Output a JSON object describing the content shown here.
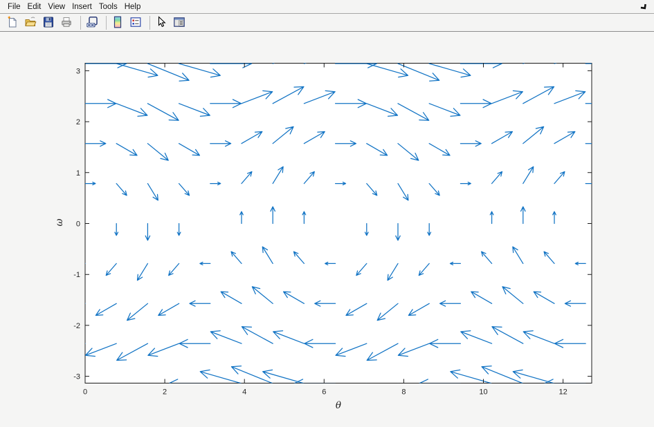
{
  "menu": {
    "items": [
      "File",
      "Edit",
      "View",
      "Insert",
      "Tools",
      "Help"
    ]
  },
  "toolbar": {
    "buttons": [
      {
        "name": "new-figure",
        "icon": "new-document-icon"
      },
      {
        "name": "open-file",
        "icon": "open-folder-icon"
      },
      {
        "name": "save-figure",
        "icon": "save-icon"
      },
      {
        "name": "print-figure",
        "icon": "print-icon"
      },
      {
        "name": "separator"
      },
      {
        "name": "link-plot",
        "icon": "link-plot-icon"
      },
      {
        "name": "separator"
      },
      {
        "name": "insert-colorbar",
        "icon": "colorbar-icon"
      },
      {
        "name": "insert-legend",
        "icon": "legend-icon"
      },
      {
        "name": "separator"
      },
      {
        "name": "edit-plot",
        "icon": "pointer-icon"
      },
      {
        "name": "show-plot-tools",
        "icon": "plot-tools-icon"
      }
    ]
  },
  "window": {
    "cursor_glyph": "se-arrow-cursor-icon"
  },
  "chart_data": {
    "type": "quiver",
    "title": "",
    "xlabel": "θ",
    "ylabel": "ω",
    "xlim": [
      0,
      12.72
    ],
    "ylim": [
      -3.1416,
      3.1416
    ],
    "x_ticks": [
      0,
      2,
      4,
      6,
      8,
      10,
      12
    ],
    "y_ticks": [
      -3,
      -2,
      -1,
      0,
      1,
      2,
      3
    ],
    "grid": false,
    "box": true,
    "legend_position": "none",
    "arrow_color": "#1173c4",
    "axis_color": "#1a1a1a",
    "background": "#ffffff",
    "arrow_scale": 0.33,
    "theta": [
      0,
      0.7854,
      1.5708,
      2.3562,
      3.1416,
      3.927,
      4.7124,
      5.4978,
      6.2832,
      7.0686,
      7.854,
      8.6394,
      9.4248,
      10.2102,
      10.9956,
      11.781,
      12.5664
    ],
    "omega": [
      -3.1416,
      -2.3562,
      -1.5708,
      -0.7854,
      0,
      0.7854,
      1.5708,
      2.3562,
      3.1416
    ],
    "u_by_row": [
      -3.1416,
      -2.3562,
      -1.5708,
      -0.7854,
      0,
      0.7854,
      1.5708,
      2.3562,
      3.1416
    ],
    "v_by_col": [
      0,
      -0.7071,
      -1,
      -0.7071,
      0,
      0.7071,
      1,
      0.7071,
      0,
      -0.7071,
      -1,
      -0.7071,
      0,
      0.7071,
      1,
      0.7071,
      0
    ]
  }
}
